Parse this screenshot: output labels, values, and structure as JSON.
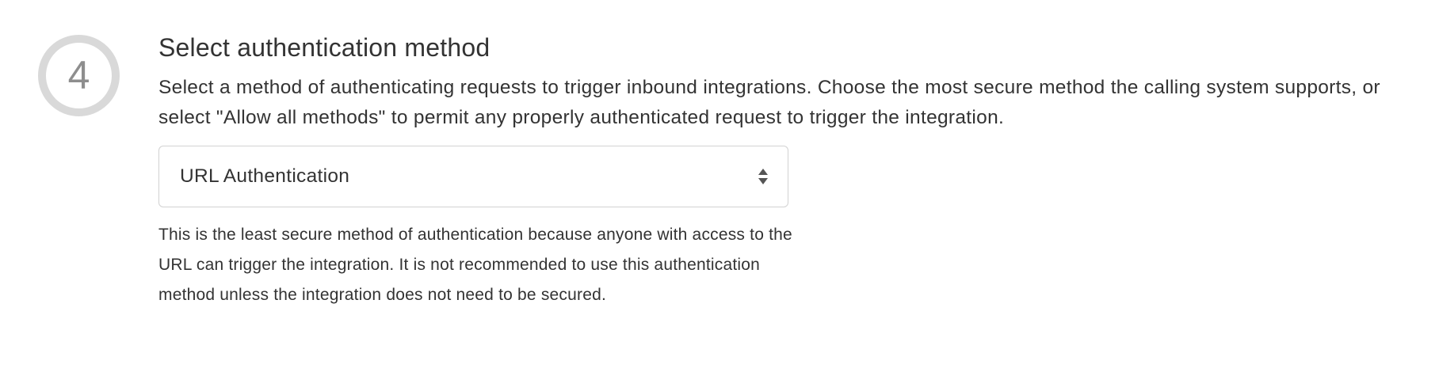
{
  "step": {
    "number": "4"
  },
  "section": {
    "title": "Select authentication method",
    "description": "Select a method of authenticating requests to trigger inbound integrations. Choose the most secure method the calling system supports, or select \"Allow all methods\" to permit any properly authenticated request to trigger the integration."
  },
  "auth_select": {
    "selected_value": "URL Authentication",
    "icon": "sort-arrows-icon"
  },
  "help": {
    "text": "This is the least secure method of authentication because anyone with access to the URL can trigger the integration. It is not recommended to use this authentication method unless the integration does not need to be secured."
  },
  "colors": {
    "step_ring": "#d9d9d9",
    "step_number": "#8e8e8e",
    "text": "#333333",
    "select_border": "#d2d2d2"
  }
}
